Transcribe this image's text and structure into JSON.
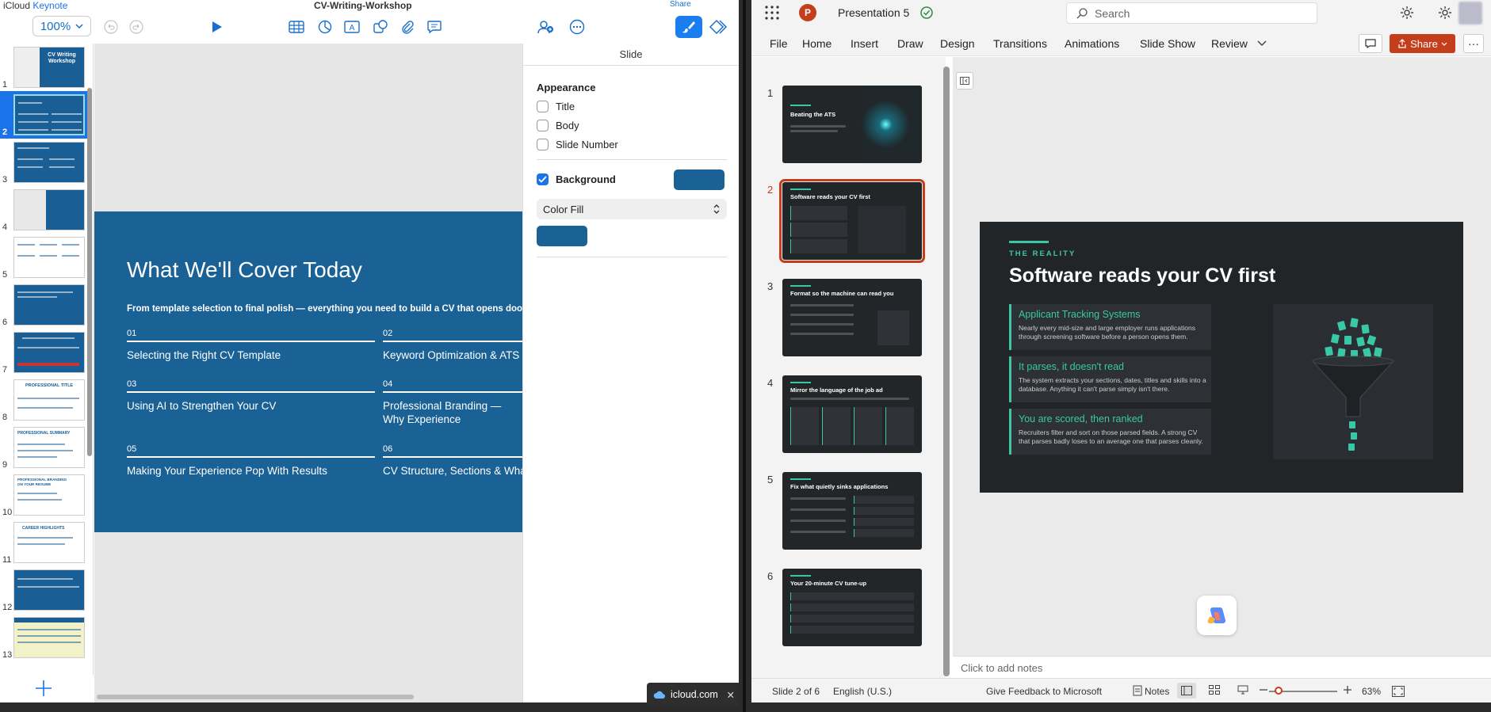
{
  "keynote": {
    "brand_icloud": "iCloud",
    "brand_keynote": "Keynote",
    "zoom": "100%",
    "doc_title": "CV-Writing-Workshop",
    "clipped_label": "Share",
    "slides": [
      {
        "num": "1"
      },
      {
        "num": "2"
      },
      {
        "num": "3"
      },
      {
        "num": "4"
      },
      {
        "num": "5"
      },
      {
        "num": "6"
      },
      {
        "num": "7"
      },
      {
        "num": "8"
      },
      {
        "num": "9"
      },
      {
        "num": "10"
      },
      {
        "num": "11"
      },
      {
        "num": "12"
      },
      {
        "num": "13"
      }
    ],
    "thumb_texts": {
      "t1": "CV Writing Workshop",
      "t8": "PROFESSIONAL TITLE",
      "t9": "PROFESSIONAL SUMMARY",
      "t10": "PROFESSIONAL BRANDING ON YOUR RESUME",
      "t11": "CAREER HIGHLIGHTS"
    },
    "slide": {
      "title": "What We'll Cover Today",
      "subtitle": "From template selection to final polish — everything you need to build a CV that opens doors.",
      "items": [
        {
          "num": "01",
          "label": "Selecting the Right CV Template"
        },
        {
          "num": "02",
          "label": "Keyword Optimization & ATS S"
        },
        {
          "num": "03",
          "label": "Using AI to Strengthen Your CV"
        },
        {
          "num": "04",
          "label": "Professional Branding — Why Experience"
        },
        {
          "num": "05",
          "label": "Making Your Experience Pop With Results"
        },
        {
          "num": "06",
          "label": "CV Structure, Sections & What"
        }
      ]
    },
    "inspector": {
      "heading": "Slide",
      "appearance": "Appearance",
      "title_label": "Title",
      "body_label": "Body",
      "slide_number_label": "Slide Number",
      "background_label": "Background",
      "fill_type": "Color Fill",
      "background_color": "#1a6196"
    },
    "popup_label": "icloud.com"
  },
  "ppt": {
    "logo": "P",
    "doc_name": "Presentation 5",
    "search_placeholder": "Search",
    "tabs": [
      "File",
      "Home",
      "Insert",
      "Draw",
      "Design",
      "Transitions",
      "Animations",
      "Slide Show",
      "Review"
    ],
    "share_label": "Share",
    "more_label": "···",
    "thumbnails": [
      {
        "num": "1",
        "title": "Beating the ATS"
      },
      {
        "num": "2",
        "title": "Software reads your CV first"
      },
      {
        "num": "3",
        "title": "Format so the machine can read you"
      },
      {
        "num": "4",
        "title": "Mirror the language of the job ad"
      },
      {
        "num": "5",
        "title": "Fix what quietly sinks applications"
      },
      {
        "num": "6",
        "title": "Your 20-minute CV tune-up"
      }
    ],
    "slide": {
      "kicker": "THE REALITY",
      "title": "Software reads your CV first",
      "cards": [
        {
          "heading": "Applicant Tracking Systems",
          "body": "Nearly every mid-size and large employer runs applications through screening software before a person opens them."
        },
        {
          "heading": "It parses, it doesn't read",
          "body": "The system extracts your sections, dates, titles and skills into a database. Anything it can't parse simply isn't there."
        },
        {
          "heading": "You are scored, then ranked",
          "body": "Recruiters filter and sort on those parsed fields. A strong CV that parses badly loses to an average one that parses cleanly."
        }
      ]
    },
    "notes_placeholder": "Click to add notes",
    "status": {
      "slide_pos": "Slide 2 of 6",
      "language": "English (U.S.)",
      "feedback": "Give Feedback to Microsoft",
      "notes": "Notes",
      "zoom": "63%"
    },
    "accent": "#c43e1c",
    "teal": "#3ac7a5"
  }
}
